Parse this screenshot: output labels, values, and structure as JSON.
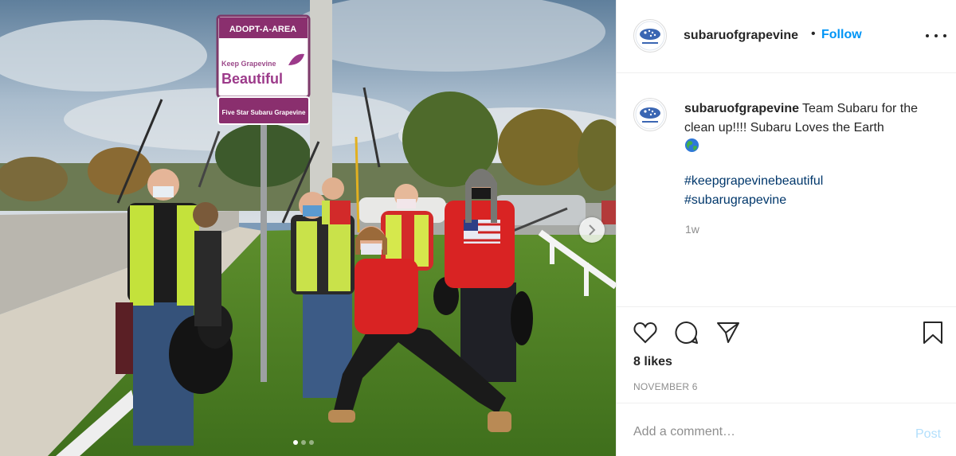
{
  "post": {
    "sign": {
      "header": "ADOPT-A-AREA",
      "line1": "Keep Grapevine",
      "line2": "Beautiful",
      "sponsor": "Five Star Subaru Grapevine"
    },
    "carousel": {
      "slides": 3,
      "active_index": 0
    }
  },
  "header": {
    "username": "subaruofgrapevine",
    "separator": "•",
    "follow_label": "Follow"
  },
  "caption": {
    "username": "subaruofgrapevine",
    "text": "Team Subaru for the clean up!!!! Subaru Loves the Earth",
    "emoji": "earth-globe",
    "hashtags": [
      "#keepgrapevinebeautiful",
      "#subarugrapevine"
    ],
    "time": "1w"
  },
  "actions": {
    "likes": "8 likes",
    "date": "NOVEMBER 6"
  },
  "comment": {
    "placeholder": "Add a comment…",
    "post_label": "Post"
  },
  "colors": {
    "accent": "#0095f6",
    "hashtag": "#00376b",
    "muted": "#8e8e8e",
    "post_disabled": "#b2dffc"
  }
}
